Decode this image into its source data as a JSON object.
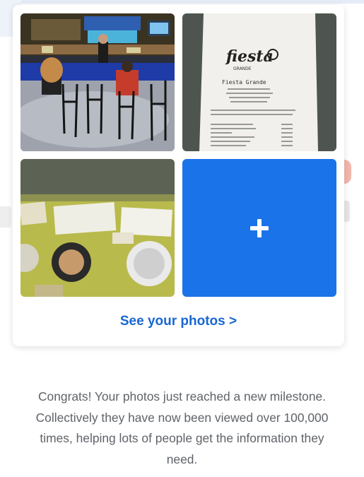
{
  "card": {
    "photos": [
      {
        "kind": "photo",
        "subject": "restaurant bar"
      },
      {
        "kind": "photo",
        "subject": "receipt",
        "receipt_brand": "fiesta",
        "receipt_sub": "GRANDE",
        "receipt_title": "Fiesta Grande"
      },
      {
        "kind": "photo",
        "subject": "stickers wall"
      },
      {
        "kind": "add",
        "icon": "plus-icon",
        "color": "#1a73e8"
      }
    ],
    "see_photos_label": "See your photos >",
    "link_color": "#1967d2"
  },
  "message": {
    "line1": "Congrats! Your photos just reached a new milestone.",
    "line2": "Collectively they have now been viewed over 100,000",
    "line3": "times, helping lots of people get the information they",
    "line4": "need."
  }
}
